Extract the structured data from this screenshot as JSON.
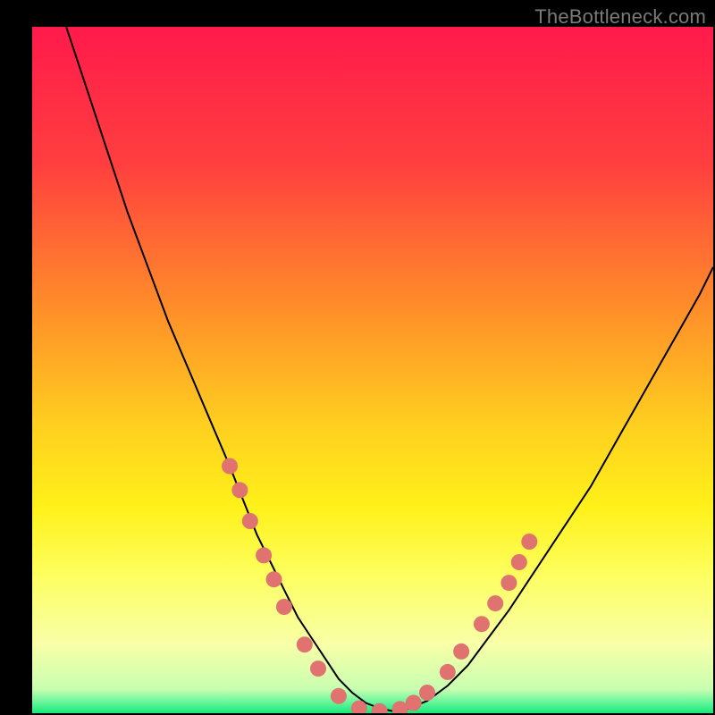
{
  "watermark": "TheBottleneck.com",
  "chart_data": {
    "type": "line",
    "title": "",
    "xlabel": "",
    "ylabel": "",
    "xlim": [
      0,
      100
    ],
    "ylim": [
      0,
      100
    ],
    "grid": false,
    "legend": false,
    "background": {
      "gradient_stops": [
        {
          "pos": 0.0,
          "color": "#ff1a4b"
        },
        {
          "pos": 0.2,
          "color": "#ff3f3f"
        },
        {
          "pos": 0.4,
          "color": "#ff8a2a"
        },
        {
          "pos": 0.58,
          "color": "#ffcf1f"
        },
        {
          "pos": 0.7,
          "color": "#fff11a"
        },
        {
          "pos": 0.8,
          "color": "#fdff60"
        },
        {
          "pos": 0.9,
          "color": "#f8ffa8"
        },
        {
          "pos": 0.965,
          "color": "#c8ffb0"
        },
        {
          "pos": 0.985,
          "color": "#60f59a"
        },
        {
          "pos": 1.0,
          "color": "#17e876"
        }
      ]
    },
    "series": [
      {
        "name": "bottleneck-curve",
        "color": "#000000",
        "stroke_width": 2,
        "x": [
          5,
          8,
          11,
          14,
          17,
          20,
          23,
          26,
          29,
          31,
          33,
          35,
          37,
          39,
          41,
          43,
          45,
          47,
          49,
          51,
          53,
          55,
          58,
          61,
          64,
          67,
          70,
          74,
          78,
          82,
          86,
          90,
          94,
          98,
          100
        ],
        "y": [
          100,
          91,
          82,
          73,
          65,
          57,
          50,
          43,
          36,
          31,
          26,
          22,
          18,
          14,
          11,
          8,
          5,
          3,
          1.5,
          0.7,
          0.3,
          0.6,
          1.8,
          4,
          7,
          11,
          15,
          21,
          27,
          33,
          40,
          47,
          54,
          61,
          65
        ]
      }
    ],
    "markers": {
      "name": "highlight-dots",
      "color": "#e0736f",
      "radius": 9,
      "points": [
        {
          "x": 29,
          "y": 36
        },
        {
          "x": 30.5,
          "y": 32.5
        },
        {
          "x": 32,
          "y": 28
        },
        {
          "x": 34,
          "y": 23
        },
        {
          "x": 35.5,
          "y": 19.5
        },
        {
          "x": 37,
          "y": 15.5
        },
        {
          "x": 40,
          "y": 10
        },
        {
          "x": 42,
          "y": 6.5
        },
        {
          "x": 45,
          "y": 2.5
        },
        {
          "x": 48,
          "y": 0.7
        },
        {
          "x": 51,
          "y": 0.3
        },
        {
          "x": 54,
          "y": 0.6
        },
        {
          "x": 56,
          "y": 1.5
        },
        {
          "x": 58,
          "y": 3
        },
        {
          "x": 61,
          "y": 6
        },
        {
          "x": 63,
          "y": 9
        },
        {
          "x": 66,
          "y": 13
        },
        {
          "x": 68,
          "y": 16
        },
        {
          "x": 70,
          "y": 19
        },
        {
          "x": 71.5,
          "y": 22
        },
        {
          "x": 73,
          "y": 25
        }
      ]
    }
  }
}
